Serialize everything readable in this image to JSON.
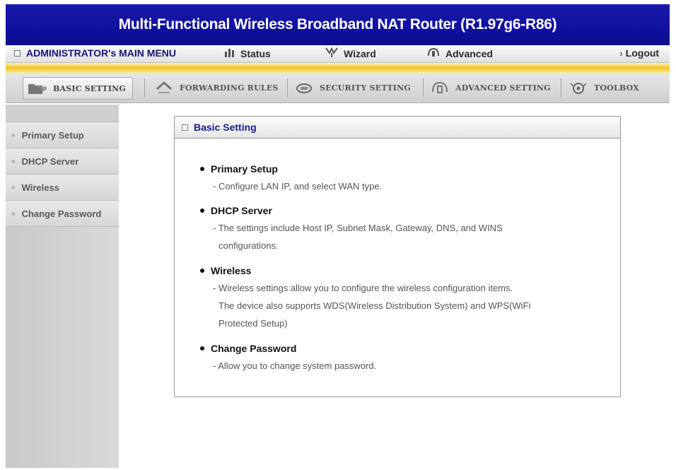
{
  "window": {
    "title": "Multi-Functional Wireless Broadband NAT Router (R1.97g6-R86)"
  },
  "main_menu": {
    "admin_label": "ADMINISTRATOR's MAIN MENU",
    "status_label": "Status",
    "wizard_label": "Wizard",
    "advanced_label": "Advanced",
    "logout_label": "Logout",
    "logout_prefix": "›"
  },
  "tabs": [
    {
      "label": "BASIC SETTING",
      "icon": "folder-icon",
      "active": true
    },
    {
      "label": "FORWARDING RULES",
      "icon": "arrows-icon",
      "active": false
    },
    {
      "label": "SECURITY SETTING",
      "icon": "lock-icon",
      "active": false
    },
    {
      "label": "ADVANCED SETTING",
      "icon": "gear-icon",
      "active": false
    },
    {
      "label": "TOOLBOX",
      "icon": "toolbox-icon",
      "active": false
    }
  ],
  "sidebar": {
    "items": [
      {
        "label": "Primary Setup"
      },
      {
        "label": "DHCP Server"
      },
      {
        "label": "Wireless"
      },
      {
        "label": "Change Password"
      }
    ]
  },
  "panel": {
    "title": "Basic Setting",
    "sections": [
      {
        "title": "Primary Setup",
        "desc": [
          "- Configure LAN IP, and select WAN type."
        ]
      },
      {
        "title": "DHCP Server",
        "desc": [
          "- The settings include Host IP, Subnet Mask, Gateway, DNS, and WINS",
          "configurations."
        ]
      },
      {
        "title": "Wireless",
        "desc": [
          "- Wireless settings allow you to configure the wireless configuration items.",
          "The device also supports WDS(Wireless Distribution System) and WPS(WiFi",
          "Protected Setup)"
        ]
      },
      {
        "title": "Change Password",
        "desc": [
          "- Allow you to change system password."
        ]
      }
    ]
  },
  "colors": {
    "title_bg": "#1414a0",
    "gold_stripe": "#f0c230",
    "sidebar_bg": "#d0d0d0",
    "panel_title": "#1a1a8a"
  }
}
